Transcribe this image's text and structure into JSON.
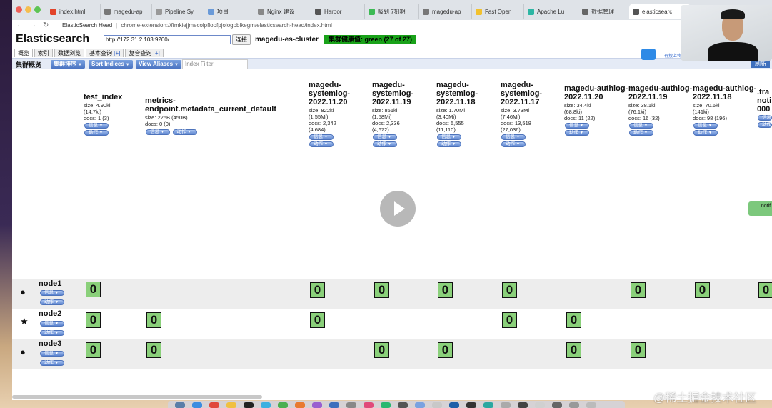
{
  "browser": {
    "tabs": [
      "index.html",
      "magedu-ap",
      "Pipeline Sy",
      "项目",
      "Nginx 建议",
      "Haroor",
      "吸到 7刻期",
      "magedu-ap",
      "Fast Open",
      "Apache Lu",
      "数据管理",
      "elasticsearc"
    ],
    "address": {
      "ext_name": "ElasticSearch Head",
      "url": "chrome-extension://ffmkiejjmecolpfloofpjologoblkegm/elasticsearch-head/index.html"
    }
  },
  "header": {
    "logo": "Elasticsearch",
    "connect_url": "http://172.31.2.103:9200/",
    "connect_button": "连接",
    "cluster_name": "magedu-es-cluster",
    "health": "集群健康值: green (27 of 27)"
  },
  "tabs": [
    {
      "label": "概览",
      "plus": ""
    },
    {
      "label": "索引",
      "plus": ""
    },
    {
      "label": "数据浏览",
      "plus": ""
    },
    {
      "label": "基本查询",
      "plus": "[+]"
    },
    {
      "label": "复合查询",
      "plus": "[+]"
    }
  ],
  "toolbar": {
    "title": "集群概览",
    "sort_cluster": "集群排序",
    "sort_indices": "Sort Indices",
    "view_aliases": "View Aliases",
    "filter_placeholder": "Index Filter",
    "refresh": "刷新"
  },
  "pill_labels": {
    "info": "信息",
    "action": "动作"
  },
  "indices": [
    {
      "name": "test_index",
      "meta": [
        "size: 4.90ki",
        "(14.7ki)",
        "docs: 1 (3)"
      ]
    },
    {
      "name": "metrics-endpoint.metadata_current_default",
      "meta": [
        "size: 225B (450B)",
        "docs: 0 (0)"
      ]
    },
    {
      "name": "magedu-systemlog-2022.11.20",
      "meta": [
        "size: 822ki",
        "(1.55Mi)",
        "docs: 2,342",
        "(4,684)"
      ]
    },
    {
      "name": "magedu-systemlog-2022.11.19",
      "meta": [
        "size: 851ki",
        "(1.58Mi)",
        "docs: 2,336",
        "(4,672)"
      ]
    },
    {
      "name": "magedu-systemlog-2022.11.18",
      "meta": [
        "size: 1.70Mi",
        "(3.40Mi)",
        "docs: 5,555",
        "(11,110)"
      ]
    },
    {
      "name": "magedu-systemlog-2022.11.17",
      "meta": [
        "size: 3.73Mi",
        "(7.46Mi)",
        "docs: 13,518",
        "(27,036)"
      ]
    },
    {
      "name": "magedu-authlog-2022.11.20",
      "meta": [
        "size: 34.4ki",
        "(68.8ki)",
        "docs: 11 (22)"
      ]
    },
    {
      "name": "magedu-authlog-2022.11.19",
      "meta": [
        "size: 38.1ki",
        "(76.1ki)",
        "docs: 16 (32)"
      ]
    },
    {
      "name": "magedu-authlog-2022.11.18",
      "meta": [
        "size: 70.6ki",
        "(141ki)",
        "docs: 98 (196)"
      ]
    },
    {
      "name": ".tra noti 000",
      "meta": []
    }
  ],
  "nodes": [
    {
      "name": "node1",
      "marker": "●",
      "shards": [
        "0",
        "0",
        "0",
        "0",
        "0",
        "0",
        "0",
        "0"
      ]
    },
    {
      "name": "node2",
      "marker": "★",
      "shards": [
        "0",
        "0",
        "0",
        "0",
        "0"
      ]
    },
    {
      "name": "node3",
      "marker": "●",
      "shards": [
        "0",
        "0",
        "0",
        "0",
        "0",
        "0"
      ]
    }
  ],
  "side_note": ". notif",
  "watermark": "@稀土掘金技术社区",
  "baidu_label": "有搜上传"
}
